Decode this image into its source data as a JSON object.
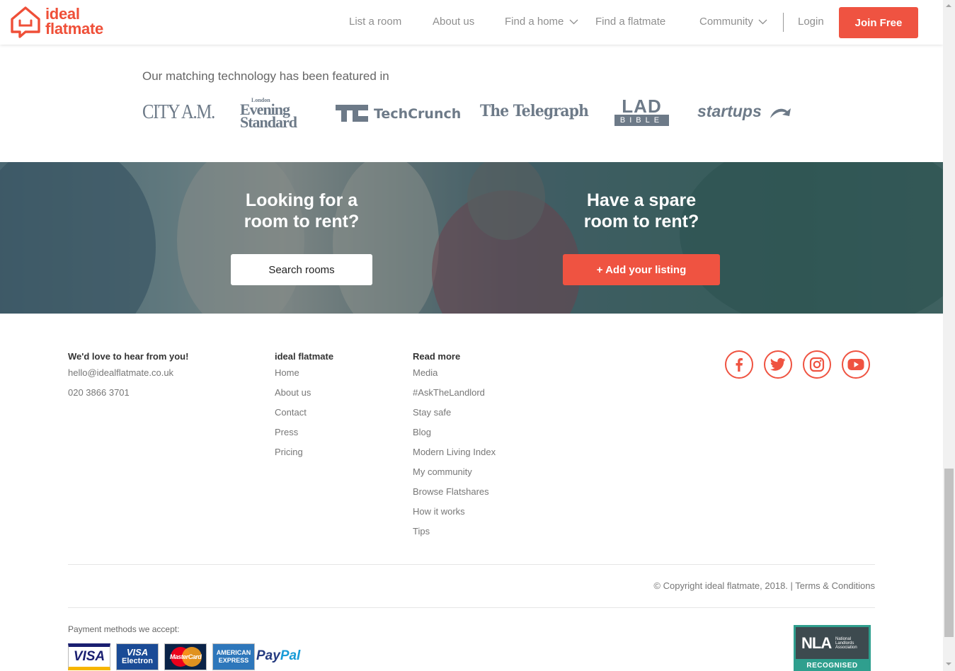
{
  "header": {
    "logo_line1": "ideal",
    "logo_line2": "flatmate",
    "nav": {
      "list_room": "List a room",
      "about": "About us",
      "find_home": "Find a home",
      "find_flatmate": "Find a flatmate",
      "community": "Community",
      "login": "Login",
      "join": "Join Free"
    }
  },
  "featured": {
    "title": "Our matching technology has been featured in",
    "logos": {
      "cityam": "CITY A.M.",
      "es_small": "London",
      "es_line1": "Evening",
      "es_line2": "Standard",
      "techcrunch": "TechCrunch",
      "telegraph": "The Telegraph",
      "lad": "LAD",
      "bible": "BIBLE",
      "startups": "startups"
    }
  },
  "banner": {
    "left_heading_1": "Looking for a",
    "left_heading_2": "room to rent?",
    "left_button": "Search rooms",
    "right_heading_1": "Have a spare",
    "right_heading_2": "room to rent?",
    "right_button": "+ Add your listing"
  },
  "footer": {
    "contact": {
      "heading": "We'd love to hear from you!",
      "email": "hello@idealflatmate.co.uk",
      "phone": "020 3866 3701"
    },
    "company": {
      "heading": "ideal flatmate",
      "links": [
        "Home",
        "About us",
        "Contact",
        "Press",
        "Pricing"
      ]
    },
    "read_more": {
      "heading": "Read more",
      "links": [
        "Media",
        "#AskTheLandlord",
        "Stay safe",
        "Blog",
        "Modern Living Index",
        "My community",
        "Browse Flatshares",
        "How it works",
        "Tips"
      ]
    },
    "copyright": "© Copyright ideal flatmate, 2018. | Terms & Conditions",
    "payment_label": "Payment methods we accept:",
    "cards": {
      "visa": "VISA",
      "visa_electron_1": "VISA",
      "visa_electron_2": "Electron",
      "mastercard": "MasterCard",
      "amex_1": "AMERICAN",
      "amex_2": "EXPRESS",
      "paypal_1": "Pay",
      "paypal_2": "Pal"
    },
    "nla": {
      "abbr": "NLA",
      "full_1": "National",
      "full_2": "Landlords",
      "full_3": "Association",
      "recognised": "RECOGNISED"
    }
  },
  "colors": {
    "brand": "#ef4f38",
    "button_red": "#ef5341",
    "nla_teal": "#2f9f8e"
  }
}
